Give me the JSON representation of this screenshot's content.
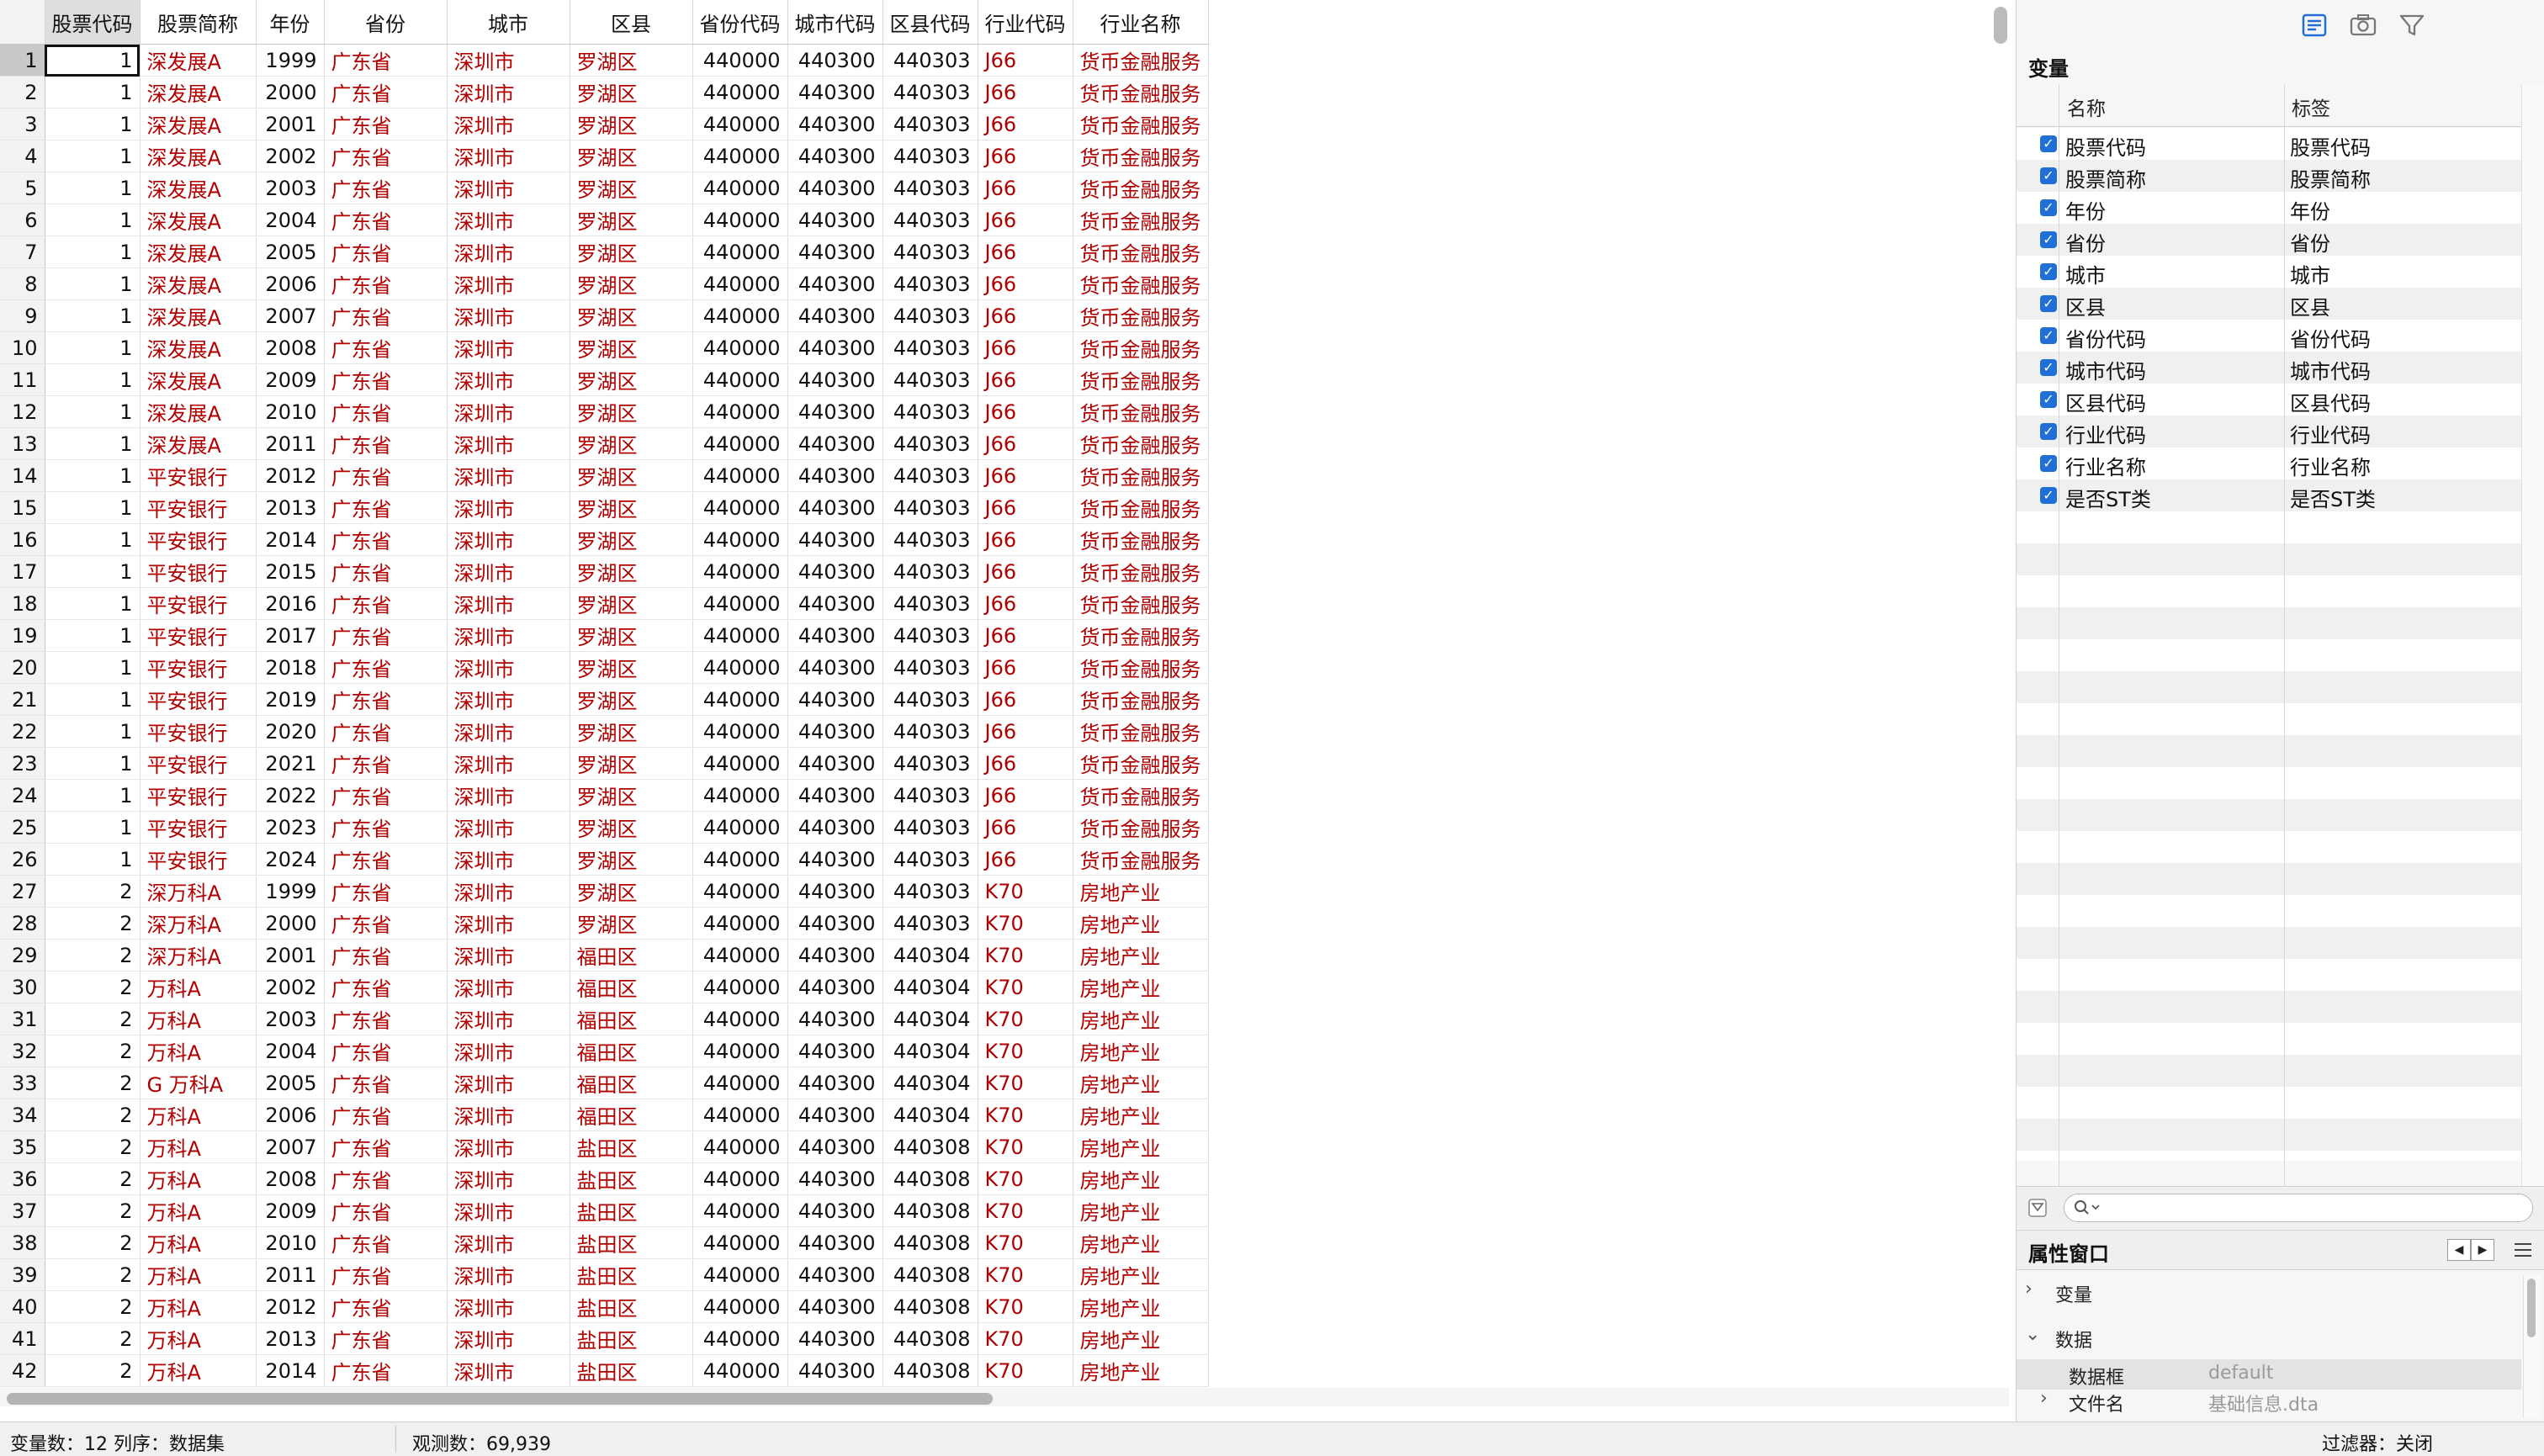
{
  "grid": {
    "columns": [
      "股票代码",
      "股票简称",
      "年份",
      "省份",
      "城市",
      "区县",
      "省份代码",
      "城市代码",
      "区县代码",
      "行业代码",
      "行业名称"
    ],
    "rows": [
      [
        "1",
        "1",
        "深发展A",
        "1999",
        "广东省",
        "深圳市",
        "罗湖区",
        "440000",
        "440300",
        "440303",
        "J66",
        "货币金融服务"
      ],
      [
        "2",
        "1",
        "深发展A",
        "2000",
        "广东省",
        "深圳市",
        "罗湖区",
        "440000",
        "440300",
        "440303",
        "J66",
        "货币金融服务"
      ],
      [
        "3",
        "1",
        "深发展A",
        "2001",
        "广东省",
        "深圳市",
        "罗湖区",
        "440000",
        "440300",
        "440303",
        "J66",
        "货币金融服务"
      ],
      [
        "4",
        "1",
        "深发展A",
        "2002",
        "广东省",
        "深圳市",
        "罗湖区",
        "440000",
        "440300",
        "440303",
        "J66",
        "货币金融服务"
      ],
      [
        "5",
        "1",
        "深发展A",
        "2003",
        "广东省",
        "深圳市",
        "罗湖区",
        "440000",
        "440300",
        "440303",
        "J66",
        "货币金融服务"
      ],
      [
        "6",
        "1",
        "深发展A",
        "2004",
        "广东省",
        "深圳市",
        "罗湖区",
        "440000",
        "440300",
        "440303",
        "J66",
        "货币金融服务"
      ],
      [
        "7",
        "1",
        "深发展A",
        "2005",
        "广东省",
        "深圳市",
        "罗湖区",
        "440000",
        "440300",
        "440303",
        "J66",
        "货币金融服务"
      ],
      [
        "8",
        "1",
        "深发展A",
        "2006",
        "广东省",
        "深圳市",
        "罗湖区",
        "440000",
        "440300",
        "440303",
        "J66",
        "货币金融服务"
      ],
      [
        "9",
        "1",
        "深发展A",
        "2007",
        "广东省",
        "深圳市",
        "罗湖区",
        "440000",
        "440300",
        "440303",
        "J66",
        "货币金融服务"
      ],
      [
        "10",
        "1",
        "深发展A",
        "2008",
        "广东省",
        "深圳市",
        "罗湖区",
        "440000",
        "440300",
        "440303",
        "J66",
        "货币金融服务"
      ],
      [
        "11",
        "1",
        "深发展A",
        "2009",
        "广东省",
        "深圳市",
        "罗湖区",
        "440000",
        "440300",
        "440303",
        "J66",
        "货币金融服务"
      ],
      [
        "12",
        "1",
        "深发展A",
        "2010",
        "广东省",
        "深圳市",
        "罗湖区",
        "440000",
        "440300",
        "440303",
        "J66",
        "货币金融服务"
      ],
      [
        "13",
        "1",
        "深发展A",
        "2011",
        "广东省",
        "深圳市",
        "罗湖区",
        "440000",
        "440300",
        "440303",
        "J66",
        "货币金融服务"
      ],
      [
        "14",
        "1",
        "平安银行",
        "2012",
        "广东省",
        "深圳市",
        "罗湖区",
        "440000",
        "440300",
        "440303",
        "J66",
        "货币金融服务"
      ],
      [
        "15",
        "1",
        "平安银行",
        "2013",
        "广东省",
        "深圳市",
        "罗湖区",
        "440000",
        "440300",
        "440303",
        "J66",
        "货币金融服务"
      ],
      [
        "16",
        "1",
        "平安银行",
        "2014",
        "广东省",
        "深圳市",
        "罗湖区",
        "440000",
        "440300",
        "440303",
        "J66",
        "货币金融服务"
      ],
      [
        "17",
        "1",
        "平安银行",
        "2015",
        "广东省",
        "深圳市",
        "罗湖区",
        "440000",
        "440300",
        "440303",
        "J66",
        "货币金融服务"
      ],
      [
        "18",
        "1",
        "平安银行",
        "2016",
        "广东省",
        "深圳市",
        "罗湖区",
        "440000",
        "440300",
        "440303",
        "J66",
        "货币金融服务"
      ],
      [
        "19",
        "1",
        "平安银行",
        "2017",
        "广东省",
        "深圳市",
        "罗湖区",
        "440000",
        "440300",
        "440303",
        "J66",
        "货币金融服务"
      ],
      [
        "20",
        "1",
        "平安银行",
        "2018",
        "广东省",
        "深圳市",
        "罗湖区",
        "440000",
        "440300",
        "440303",
        "J66",
        "货币金融服务"
      ],
      [
        "21",
        "1",
        "平安银行",
        "2019",
        "广东省",
        "深圳市",
        "罗湖区",
        "440000",
        "440300",
        "440303",
        "J66",
        "货币金融服务"
      ],
      [
        "22",
        "1",
        "平安银行",
        "2020",
        "广东省",
        "深圳市",
        "罗湖区",
        "440000",
        "440300",
        "440303",
        "J66",
        "货币金融服务"
      ],
      [
        "23",
        "1",
        "平安银行",
        "2021",
        "广东省",
        "深圳市",
        "罗湖区",
        "440000",
        "440300",
        "440303",
        "J66",
        "货币金融服务"
      ],
      [
        "24",
        "1",
        "平安银行",
        "2022",
        "广东省",
        "深圳市",
        "罗湖区",
        "440000",
        "440300",
        "440303",
        "J66",
        "货币金融服务"
      ],
      [
        "25",
        "1",
        "平安银行",
        "2023",
        "广东省",
        "深圳市",
        "罗湖区",
        "440000",
        "440300",
        "440303",
        "J66",
        "货币金融服务"
      ],
      [
        "26",
        "1",
        "平安银行",
        "2024",
        "广东省",
        "深圳市",
        "罗湖区",
        "440000",
        "440300",
        "440303",
        "J66",
        "货币金融服务"
      ],
      [
        "27",
        "2",
        "深万科A",
        "1999",
        "广东省",
        "深圳市",
        "罗湖区",
        "440000",
        "440300",
        "440303",
        "K70",
        "房地产业"
      ],
      [
        "28",
        "2",
        "深万科A",
        "2000",
        "广东省",
        "深圳市",
        "罗湖区",
        "440000",
        "440300",
        "440303",
        "K70",
        "房地产业"
      ],
      [
        "29",
        "2",
        "深万科A",
        "2001",
        "广东省",
        "深圳市",
        "福田区",
        "440000",
        "440300",
        "440304",
        "K70",
        "房地产业"
      ],
      [
        "30",
        "2",
        "万科A",
        "2002",
        "广东省",
        "深圳市",
        "福田区",
        "440000",
        "440300",
        "440304",
        "K70",
        "房地产业"
      ],
      [
        "31",
        "2",
        "万科A",
        "2003",
        "广东省",
        "深圳市",
        "福田区",
        "440000",
        "440300",
        "440304",
        "K70",
        "房地产业"
      ],
      [
        "32",
        "2",
        "万科A",
        "2004",
        "广东省",
        "深圳市",
        "福田区",
        "440000",
        "440300",
        "440304",
        "K70",
        "房地产业"
      ],
      [
        "33",
        "2",
        "G 万科A",
        "2005",
        "广东省",
        "深圳市",
        "福田区",
        "440000",
        "440300",
        "440304",
        "K70",
        "房地产业"
      ],
      [
        "34",
        "2",
        "万科A",
        "2006",
        "广东省",
        "深圳市",
        "福田区",
        "440000",
        "440300",
        "440304",
        "K70",
        "房地产业"
      ],
      [
        "35",
        "2",
        "万科A",
        "2007",
        "广东省",
        "深圳市",
        "盐田区",
        "440000",
        "440300",
        "440308",
        "K70",
        "房地产业"
      ],
      [
        "36",
        "2",
        "万科A",
        "2008",
        "广东省",
        "深圳市",
        "盐田区",
        "440000",
        "440300",
        "440308",
        "K70",
        "房地产业"
      ],
      [
        "37",
        "2",
        "万科A",
        "2009",
        "广东省",
        "深圳市",
        "盐田区",
        "440000",
        "440300",
        "440308",
        "K70",
        "房地产业"
      ],
      [
        "38",
        "2",
        "万科A",
        "2010",
        "广东省",
        "深圳市",
        "盐田区",
        "440000",
        "440300",
        "440308",
        "K70",
        "房地产业"
      ],
      [
        "39",
        "2",
        "万科A",
        "2011",
        "广东省",
        "深圳市",
        "盐田区",
        "440000",
        "440300",
        "440308",
        "K70",
        "房地产业"
      ],
      [
        "40",
        "2",
        "万科A",
        "2012",
        "广东省",
        "深圳市",
        "盐田区",
        "440000",
        "440300",
        "440308",
        "K70",
        "房地产业"
      ],
      [
        "41",
        "2",
        "万科A",
        "2013",
        "广东省",
        "深圳市",
        "盐田区",
        "440000",
        "440300",
        "440308",
        "K70",
        "房地产业"
      ],
      [
        "42",
        "2",
        "万科A",
        "2014",
        "广东省",
        "深圳市",
        "盐田区",
        "440000",
        "440300",
        "440308",
        "K70",
        "房地产业"
      ]
    ]
  },
  "right_panel": {
    "toolbar_icons": [
      "variables-icon",
      "snapshot-camera-icon",
      "filter-icon"
    ],
    "variables_title": "变量",
    "var_headers": {
      "name": "名称",
      "label": "标签"
    },
    "variables": [
      {
        "name": "股票代码",
        "label": "股票代码"
      },
      {
        "name": "股票简称",
        "label": "股票简称"
      },
      {
        "name": "年份",
        "label": "年份"
      },
      {
        "name": "省份",
        "label": "省份"
      },
      {
        "name": "城市",
        "label": "城市"
      },
      {
        "name": "区县",
        "label": "区县"
      },
      {
        "name": "省份代码",
        "label": "省份代码"
      },
      {
        "name": "城市代码",
        "label": "城市代码"
      },
      {
        "name": "区县代码",
        "label": "区县代码"
      },
      {
        "name": "行业代码",
        "label": "行业代码"
      },
      {
        "name": "行业名称",
        "label": "行业名称"
      },
      {
        "name": "是否ST类",
        "label": "是否ST类"
      }
    ],
    "properties_title": "属性窗口",
    "properties": {
      "variables_section": "变量",
      "data_section": "数据",
      "frame_name": "数据框",
      "frame_value": "default",
      "filename_name": "文件名",
      "filename_value": "基础信息.dta"
    }
  },
  "status": {
    "var_count": "变量数：12  列序：数据集",
    "obs_count": "观测数：69,939",
    "filter": "过滤器：关闭"
  },
  "colors": {
    "string_text": "#b00000",
    "checkbox": "#1f6fd6"
  }
}
